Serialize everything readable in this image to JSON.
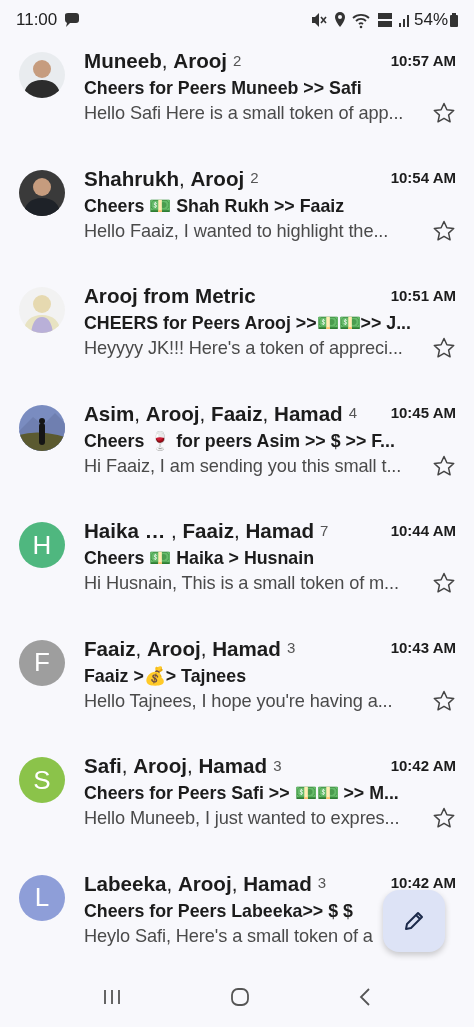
{
  "status_bar": {
    "time": "11:00",
    "battery": "54%"
  },
  "emails": [
    {
      "senders": "**Muneeb**, **Arooj**",
      "count": "2",
      "time": "10:57 AM",
      "subject": "Cheers for Peers Muneeb >> Safi",
      "snippet": "Hello Safi Here is a small token of app...",
      "starred": false
    },
    {
      "senders": "**Shahrukh**, **Arooj**",
      "count": "2",
      "time": "10:54 AM",
      "subject": "Cheers 💵 Shah Rukh >> Faaiz",
      "snippet": "Hello Faaiz, I wanted to highlight the...",
      "starred": false
    },
    {
      "senders": "**Arooj from Metric**",
      "time": "10:51 AM",
      "subject": "CHEERS for Peers Arooj >>💵💵>> J...",
      "snippet": "Heyyyy JK!!! Here's a token of appreci...",
      "starred": false
    },
    {
      "senders": "**Asim**, **Arooj**, **Faaiz**, **Hamad**",
      "count": "4",
      "time": "10:45 AM",
      "subject": "Cheers 🍷 for peers Asim >> $ >> F...",
      "snippet": "Hi Faaiz, I am sending you this small t...",
      "starred": false
    },
    {
      "avatar": {
        "kind": "letter",
        "letter": "H",
        "color": "#4fb77f"
      },
      "senders": "**Haika …** , **Faaiz**, **Hamad**",
      "count": "7",
      "time": "10:44 AM",
      "subject": "Cheers 💵 Haika > Husnain",
      "snippet": "Hi Husnain, This is a small token of m...",
      "starred": false
    },
    {
      "avatar": {
        "kind": "letter",
        "letter": "F",
        "color": "#9e9e9e"
      },
      "senders": "**Faaiz**, **Arooj**, **Hamad**",
      "count": "3",
      "time": "10:43 AM",
      "subject": "Faaiz >💰> Tajnees",
      "snippet": "Hello Tajnees, I hope you're having a...",
      "starred": false
    },
    {
      "avatar": {
        "kind": "letter",
        "letter": "S",
        "color": "#8bc34a"
      },
      "senders": "**Safi**, **Arooj**, **Hamad**",
      "count": "3",
      "time": "10:42 AM",
      "subject": "Cheers for Peers Safi >> 💵💵 >> M...",
      "snippet": "Hello Muneeb, I just wanted to expres...",
      "starred": false
    },
    {
      "avatar": {
        "kind": "letter",
        "letter": "L",
        "color": "#8e9ed8"
      },
      "senders": "**Labeeka**, **Arooj**, **Hamad**",
      "count": "3",
      "time": "10:42 AM",
      "subject": "Cheers for Peers Labeeka>> $ $",
      "snippet": "Heylo Safi, Here's a small token of a"
    }
  ]
}
